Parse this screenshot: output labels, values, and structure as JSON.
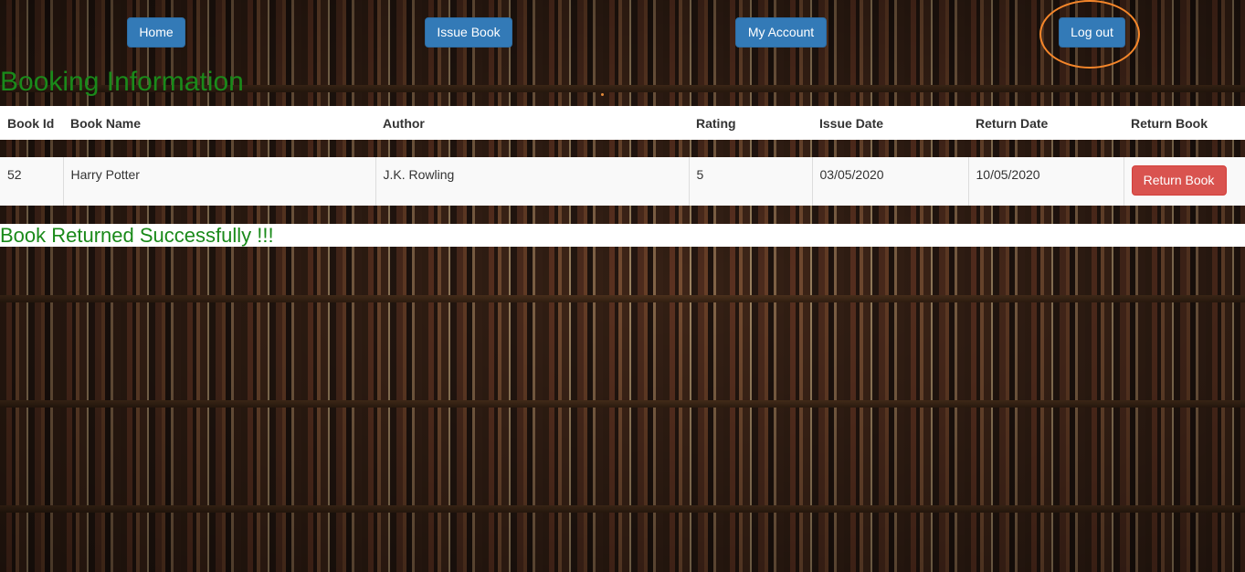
{
  "nav": {
    "home_label": "Home",
    "issue_label": "Issue Book",
    "account_label": "My Account",
    "logout_label": "Log out"
  },
  "colors": {
    "primary_button": "#337ab7",
    "danger_button": "#d9534f",
    "title_green": "#1a8a1a",
    "highlight_ring": "#f5862a"
  },
  "page_title": "Booking Information",
  "table": {
    "headers": [
      "Book Id",
      "Book Name",
      "Author",
      "Rating",
      "Issue Date",
      "Return Date",
      "Return Book"
    ],
    "rows": [
      {
        "book_id": "52",
        "book_name": "Harry Potter",
        "author": "J.K. Rowling",
        "rating": "5",
        "issue_date": "03/05/2020",
        "return_date": "10/05/2020",
        "action_label": "Return Book"
      }
    ]
  },
  "success_message": "Book Returned Successfully !!!"
}
